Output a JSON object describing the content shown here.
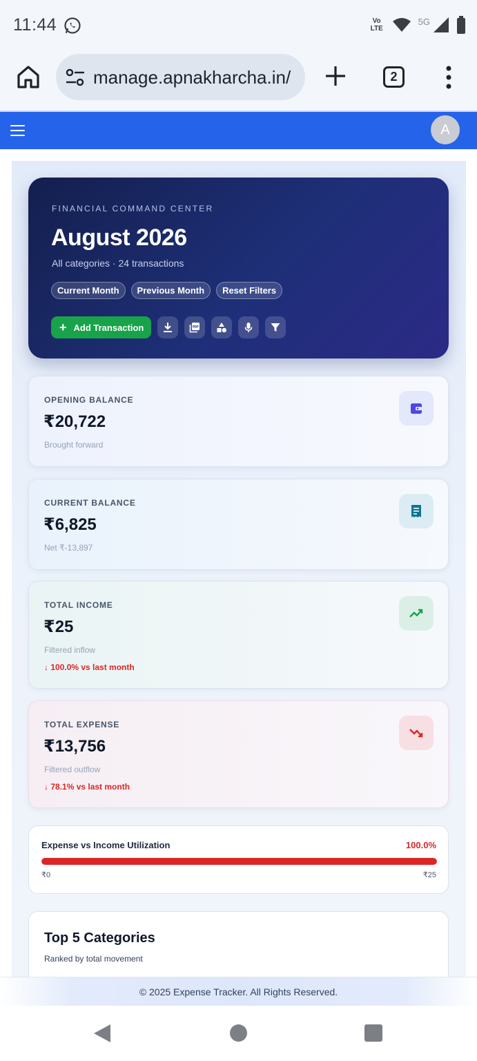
{
  "status": {
    "time": "11:44",
    "network": "5G",
    "volte": "Vo LTE"
  },
  "browser": {
    "url": "manage.apnakharcha.in/",
    "tab_count": "2"
  },
  "header": {
    "avatar_initial": "A"
  },
  "hero": {
    "eyebrow": "FINANCIAL COMMAND CENTER",
    "title": "August 2026",
    "subtitle": "All categories · 24 transactions",
    "chips": [
      "Current Month",
      "Previous Month",
      "Reset Filters"
    ],
    "add_label": "Add Transaction",
    "pdf_label": "PDF"
  },
  "cards": {
    "opening": {
      "label": "OPENING BALANCE",
      "value": "₹20,722",
      "note": "Brought forward"
    },
    "current": {
      "label": "CURRENT BALANCE",
      "value": "₹6,825",
      "note": "Net ₹-13,897"
    },
    "income": {
      "label": "TOTAL INCOME",
      "value": "₹25",
      "note": "Filtered inflow",
      "trend": "↓ 100.0% vs last month"
    },
    "expense": {
      "label": "TOTAL EXPENSE",
      "value": "₹13,756",
      "note": "Filtered outflow",
      "trend": "↓ 78.1% vs last month"
    }
  },
  "utilization": {
    "title": "Expense vs Income Utilization",
    "percent": "100.0%",
    "fill_fraction": 1.0,
    "min_label": "₹0",
    "max_label": "₹25"
  },
  "top_categories": {
    "title": "Top 5 Categories",
    "subtitle": "Ranked by total movement"
  },
  "footer": {
    "text": "© 2025 Expense Tracker. All Rights Reserved."
  },
  "colors": {
    "app_header": "#2563eb",
    "add_button": "#18a34a",
    "negative": "#dc2626",
    "income_icon": "#16a34a",
    "opening_icon": "#4f46e5",
    "current_icon": "#0e7490"
  }
}
